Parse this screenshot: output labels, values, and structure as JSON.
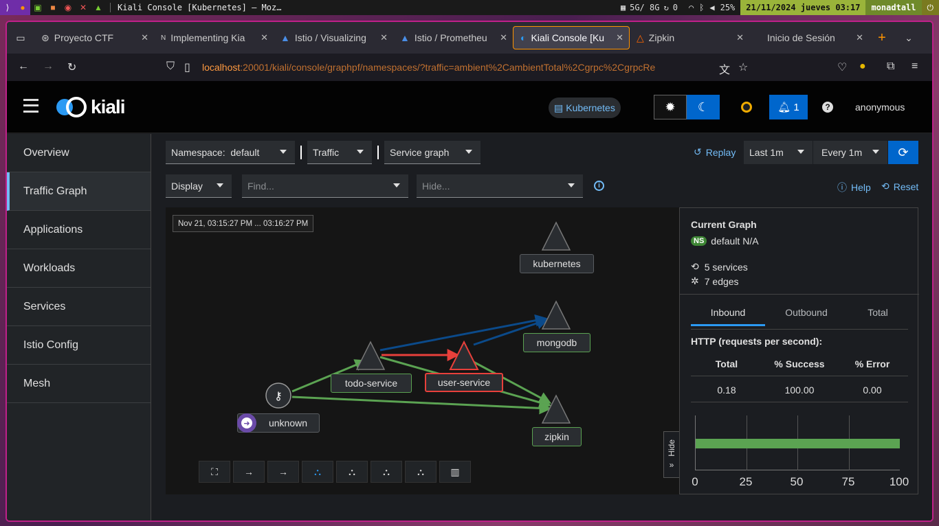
{
  "system": {
    "window_title": "Kiali Console [Kubernetes] — Moz…",
    "resources": "5G/ 8G",
    "sync_count": "0",
    "battery": "25%",
    "datetime": "21/11/2024 jueves 03:17",
    "user": "monadtall"
  },
  "browser": {
    "tabs": [
      {
        "label": "Proyecto CTF",
        "icon": "ctf-icon"
      },
      {
        "label": "Implementing Kia",
        "icon": "n-icon"
      },
      {
        "label": "Istio / Visualizing",
        "icon": "istio-icon"
      },
      {
        "label": "Istio / Prometheu",
        "icon": "istio-icon"
      },
      {
        "label": "Kiali Console [Ku",
        "icon": "kiali-icon",
        "active": true
      },
      {
        "label": "Zipkin",
        "icon": "zipkin-icon"
      },
      {
        "label": "Inicio de Sesión",
        "icon": "login-icon"
      }
    ],
    "url_host": "localhost",
    "url_rest": ":20001/kiali/console/graphpf/namespaces/?traffic=ambient%2CambientTotal%2Cgrpc%2CgrpcRe"
  },
  "masthead": {
    "brand": "kiali",
    "cluster": "Kubernetes",
    "notifications": "1",
    "user": "anonymous"
  },
  "sidebar": {
    "items": [
      {
        "label": "Overview"
      },
      {
        "label": "Traffic Graph",
        "active": true
      },
      {
        "label": "Applications"
      },
      {
        "label": "Workloads"
      },
      {
        "label": "Services"
      },
      {
        "label": "Istio Config"
      },
      {
        "label": "Mesh"
      }
    ]
  },
  "toolbar": {
    "namespace_label": "Namespace:",
    "namespace_value": "default",
    "traffic": "Traffic",
    "graph_type": "Service graph",
    "replay": "Replay",
    "duration": "Last 1m",
    "refresh": "Every 1m",
    "display": "Display",
    "find_placeholder": "Find...",
    "hide_placeholder": "Hide...",
    "help": "Help",
    "reset": "Reset"
  },
  "graph": {
    "timestamp": "Nov 21, 03:15:27 PM ... 03:16:27 PM",
    "nodes": [
      {
        "label": "kubernetes"
      },
      {
        "label": "mongodb"
      },
      {
        "label": "todo-service"
      },
      {
        "label": "user-service"
      },
      {
        "label": "zipkin"
      },
      {
        "label": "unknown"
      }
    ],
    "hide_label": "Hide",
    "colors": {
      "ok": "#5ba352",
      "error": "#e8403b",
      "tcp": "#0b4a8a"
    }
  },
  "panel": {
    "title": "Current Graph",
    "ns_badge": "NS",
    "namespace": "default N/A",
    "services": "5 services",
    "edges": "7 edges",
    "tabs": [
      "Inbound",
      "Outbound",
      "Total"
    ],
    "active_tab": "Inbound",
    "http_title": "HTTP (requests per second):",
    "headers": [
      "Total",
      "% Success",
      "% Error"
    ],
    "values": [
      "0.18",
      "100.00",
      "0.00"
    ],
    "axis_ticks": [
      "0",
      "25",
      "50",
      "75",
      "100"
    ],
    "success_bar_percent": 100
  }
}
